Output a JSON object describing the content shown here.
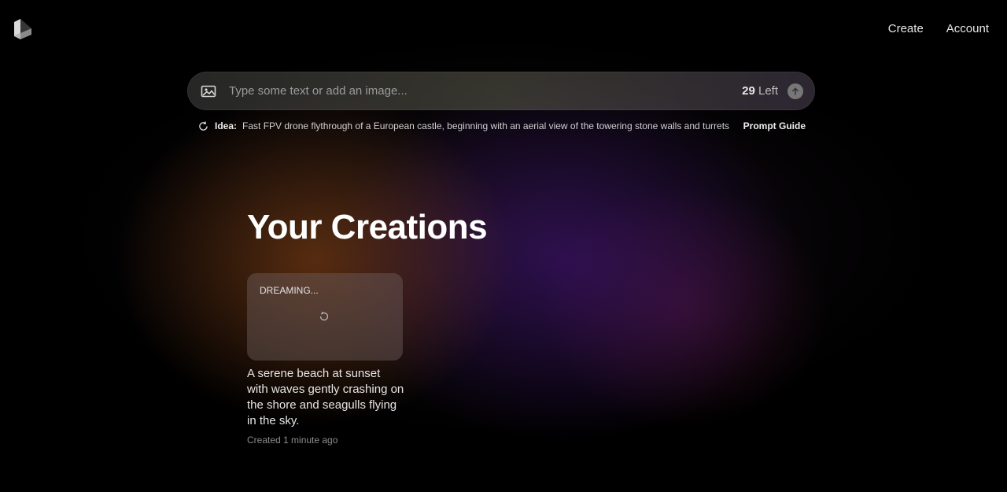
{
  "nav": {
    "create_label": "Create",
    "account_label": "Account"
  },
  "prompt": {
    "placeholder": "Type some text or add an image...",
    "credits_count": "29",
    "credits_suffix": " Left"
  },
  "idea": {
    "label": "Idea:",
    "text": "Fast FPV drone flythrough of a European castle, beginning with an aerial view of the towering stone walls and turrets",
    "guide_label": "Prompt Guide"
  },
  "creations": {
    "title": "Your Creations",
    "items": [
      {
        "status": "DREAMING...",
        "description": "A serene beach at sunset with waves gently crashing on the shore and seagulls flying in the sky.",
        "created": "Created 1 minute ago"
      }
    ]
  },
  "icons": {
    "logo": "cube-logo-icon",
    "image": "image-icon",
    "submit": "arrow-up-icon",
    "refresh": "refresh-icon",
    "loading": "loading-spinner-icon"
  },
  "colors": {
    "background": "#000000",
    "text": "#ffffff",
    "muted": "#8c8c8c"
  }
}
